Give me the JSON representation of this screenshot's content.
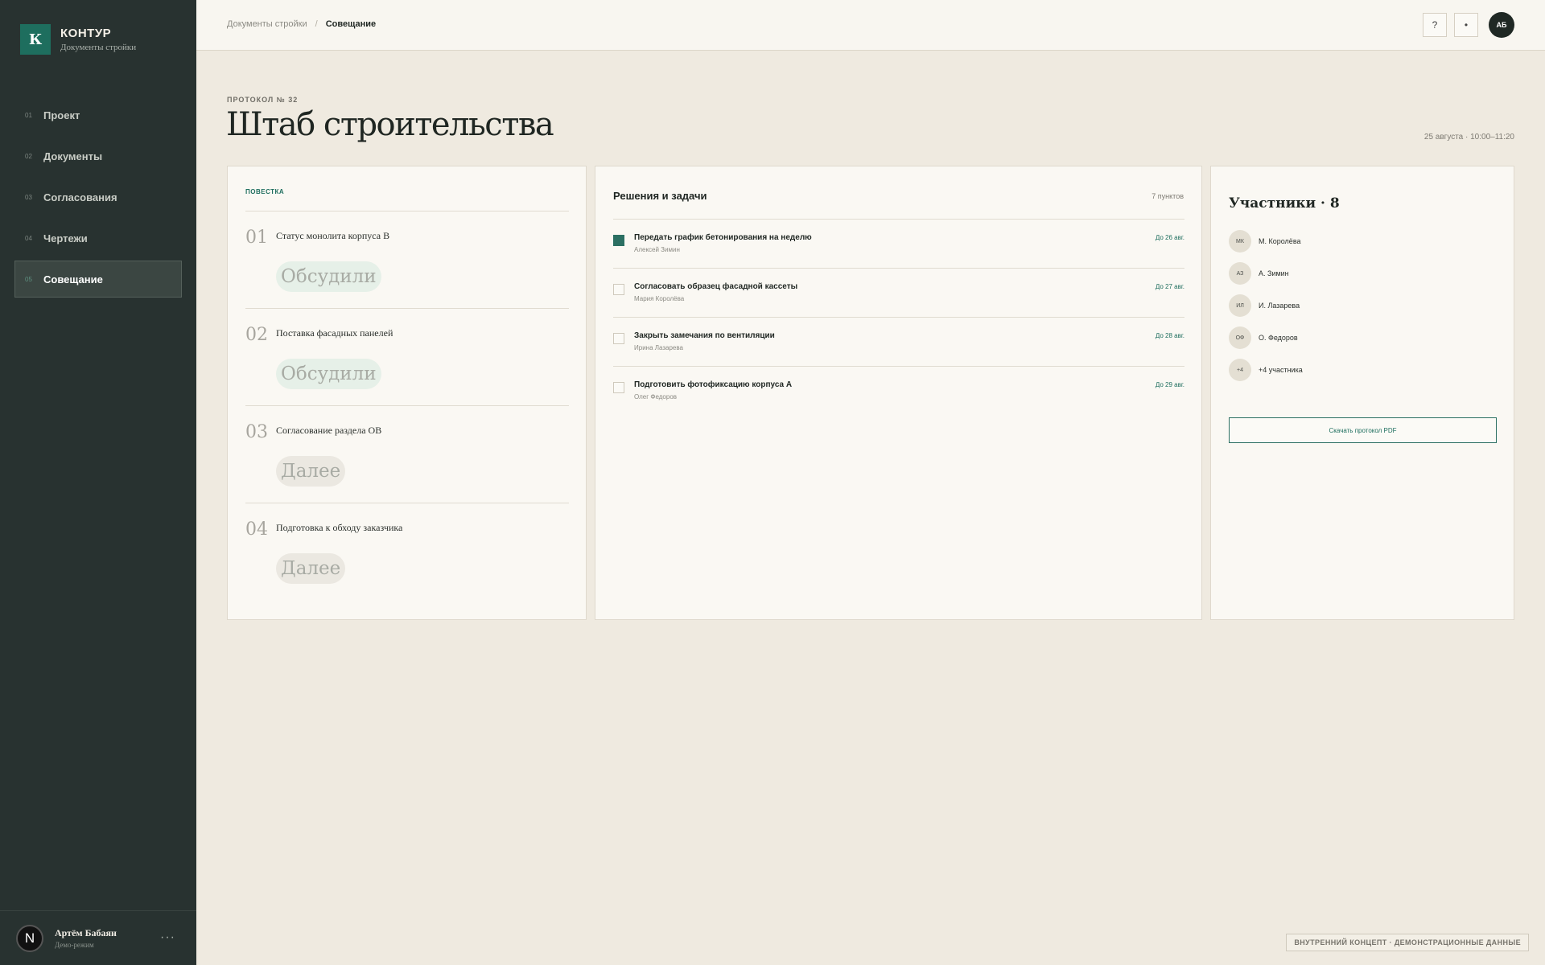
{
  "brand": {
    "logo": "К",
    "title": "КОНТУР",
    "subtitle": "Документы стройки"
  },
  "nav": [
    {
      "num": "01",
      "label": "Проект"
    },
    {
      "num": "02",
      "label": "Документы"
    },
    {
      "num": "03",
      "label": "Согласования"
    },
    {
      "num": "04",
      "label": "Чертежи"
    },
    {
      "num": "05",
      "label": "Совещание",
      "active": true
    }
  ],
  "user": {
    "initial": "N",
    "name": "Артём Бабаян",
    "mode": "Демо-режим",
    "more": "···"
  },
  "breadcrumb": {
    "parent": "Документы стройки",
    "separator": "/",
    "current": "Совещание"
  },
  "topbar": {
    "help": "?",
    "dot": "•",
    "avatar": "АБ"
  },
  "header": {
    "eyebrow": "ПРОТОКОЛ № 32",
    "title": "Штаб строительства",
    "meta": "25 августа · 10:00–11:20"
  },
  "agenda": {
    "heading": "ПОВЕСТКА",
    "items": [
      {
        "num": "01",
        "text": "Статус монолита корпуса В",
        "status": "Обсудили"
      },
      {
        "num": "02",
        "text": "Поставка фасадных панелей",
        "status": "Обсудили"
      },
      {
        "num": "03",
        "text": "Согласование раздела ОВ",
        "status": "Далее"
      },
      {
        "num": "04",
        "text": "Подготовка к обходу заказчика",
        "status": "Далее"
      }
    ]
  },
  "tasks": {
    "title": "Решения и задачи",
    "count": "7 пунктов",
    "items": [
      {
        "title": "Передать график бетонирования на неделю",
        "owner": "Алексей Зимин",
        "due": "До 26 авг.",
        "checked": true
      },
      {
        "title": "Согласовать образец фасадной кассеты",
        "owner": "Мария Королёва",
        "due": "До 27 авг.",
        "checked": false
      },
      {
        "title": "Закрыть замечания по вентиляции",
        "owner": "Ирина Лазарева",
        "due": "До 28 авг.",
        "checked": false
      },
      {
        "title": "Подготовить фотофиксацию корпуса А",
        "owner": "Олег Федоров",
        "due": "До 29 авг.",
        "checked": false
      }
    ]
  },
  "participants": {
    "title": "Участники · 8",
    "items": [
      {
        "initials": "МК",
        "name": "М. Королёва"
      },
      {
        "initials": "АЗ",
        "name": "А. Зимин"
      },
      {
        "initials": "ИЛ",
        "name": "И. Лазарева"
      },
      {
        "initials": "ОФ",
        "name": "О. Федоров"
      },
      {
        "initials": "+4",
        "name": "+4 участника"
      }
    ],
    "download": "Скачать протокол PDF"
  },
  "footer": "ВНУТРЕННИЙ КОНЦЕПТ · ДЕМОНСТРАЦИОННЫЕ ДАННЫЕ"
}
